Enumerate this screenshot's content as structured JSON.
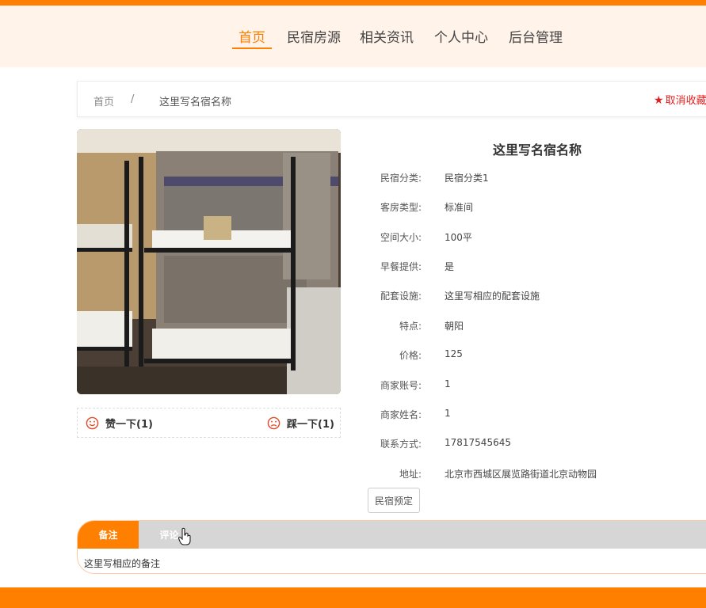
{
  "nav": {
    "items": [
      {
        "label": "首页",
        "active": true
      },
      {
        "label": "民宿房源",
        "active": false
      },
      {
        "label": "相关资讯",
        "active": false
      },
      {
        "label": "个人中心",
        "active": false
      },
      {
        "label": "后台管理",
        "active": false
      }
    ]
  },
  "breadcrumb": {
    "home": "首页",
    "separator": "/",
    "current": "这里写名宿名称",
    "favorite_label": "取消收藏"
  },
  "votes": {
    "like": "赞一下(1)",
    "dislike": "踩一下(1)"
  },
  "detail": {
    "title": "这里写名宿名称",
    "fields": [
      {
        "label": "民宿分类:",
        "value": "民宿分类1"
      },
      {
        "label": "客房类型:",
        "value": "标准间"
      },
      {
        "label": "空间大小:",
        "value": "100平"
      },
      {
        "label": "早餐提供:",
        "value": "是"
      },
      {
        "label": "配套设施:",
        "value": "这里写相应的配套设施"
      },
      {
        "label": "特点:",
        "value": "朝阳"
      },
      {
        "label": "价格:",
        "value": "125"
      },
      {
        "label": "商家账号:",
        "value": "1"
      },
      {
        "label": "商家姓名:",
        "value": "1"
      },
      {
        "label": "联系方式:",
        "value": "17817545645"
      },
      {
        "label": "地址:",
        "value": "北京市西城区展览路街道北京动物园"
      }
    ],
    "book_label": "民宿预定"
  },
  "tabs": {
    "items": [
      {
        "label": "备注",
        "active": true
      },
      {
        "label": "评论",
        "active": false
      }
    ],
    "content": "这里写相应的备注"
  },
  "colors": {
    "accent": "#ff7f00",
    "nav_bg": "#fff3ea",
    "favorite": "#e02020",
    "tab_bar": "#d6d6d6"
  }
}
